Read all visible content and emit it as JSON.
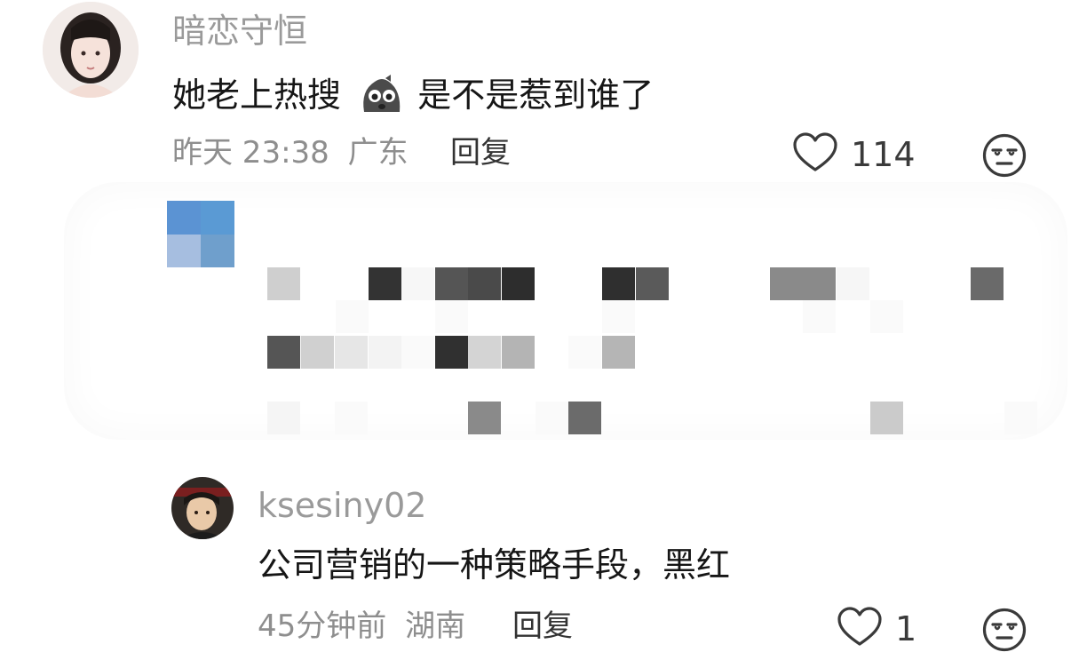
{
  "comment1": {
    "username": "暗恋守恒",
    "text_before": "她老上热搜",
    "emoji_icon": "crying-face-sticker-icon",
    "text_after": "是不是惹到谁了",
    "time": "昨天 23:38",
    "location": "广东",
    "reply_label": "回复",
    "like_count": "114"
  },
  "reply1": {
    "username": "ksesiny02",
    "text": "公司营销的一种策略手段，黑红",
    "time": "45分钟前",
    "location": "湖南",
    "reply_label": "回复",
    "like_count": "1"
  },
  "colors": {
    "username": "#9a9a9a",
    "text": "#161616",
    "meta": "#8e8e8e",
    "accent_blue": "#4a90d9"
  }
}
